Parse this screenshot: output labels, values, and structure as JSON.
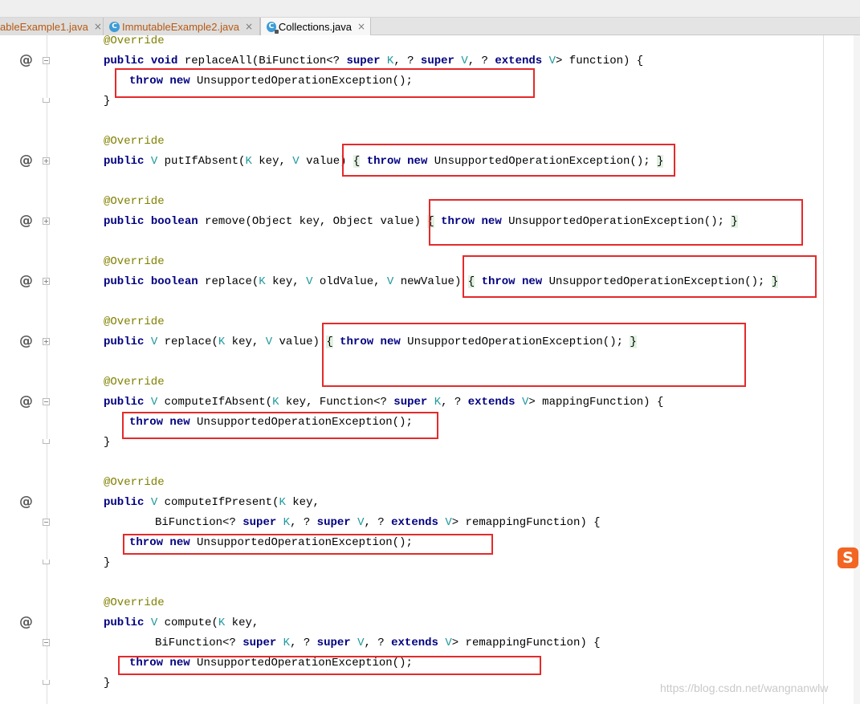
{
  "tabs": [
    {
      "label": "ableExample1.java",
      "close": "×",
      "active": false
    },
    {
      "label": "ImmutableExample2.java",
      "icon": "C",
      "close": "×",
      "active": false
    },
    {
      "label": "Collections.java",
      "icon": "C",
      "close": "×",
      "active": true
    }
  ],
  "code": {
    "override": "@Override",
    "kw_public": "public",
    "kw_void": "void",
    "kw_boolean": "boolean",
    "kw_throw": "throw",
    "kw_new": "new",
    "kw_super": "super",
    "kw_extends": "extends",
    "type_v": "V",
    "type_k": "K",
    "exception": "UnsupportedOperationException();",
    "replace_all_name": "replaceAll(BiFunction<?",
    "replace_all_mid": "K, ?",
    "replace_all_mid2": "V, ?",
    "replace_all_end": "> function) {",
    "close_brace": "}",
    "open_brace": "{",
    "put_if_absent": "putIfAbsent(",
    "key_comma": " key, ",
    "value_paren": " value)",
    "remove": "remove(Object key, Object value)",
    "replace3_name": "replace(",
    "old_value": " oldValue, ",
    "new_value": " newValue)",
    "replace2_name": "replace(",
    "compute_if_absent": "computeIfAbsent(",
    "function_q": " key, Function<?",
    "mapping_function": "> mappingFunction) {",
    "compute_if_present": "computeIfPresent(",
    "key_comma_only": " key,",
    "bifunction_q": "BiFunction<?",
    "remapping_function": "> remappingFunction) {",
    "compute": "compute(",
    "comma_q": ", ?"
  },
  "gutter_marker": "@",
  "ime_icon": "S",
  "watermark": "https://blog.csdn.net/wangnanwlw",
  "colors": {
    "keyword": "#000080",
    "annotation": "#808000",
    "type_param": "#20999d",
    "highlight_box": "#e52a2a"
  }
}
